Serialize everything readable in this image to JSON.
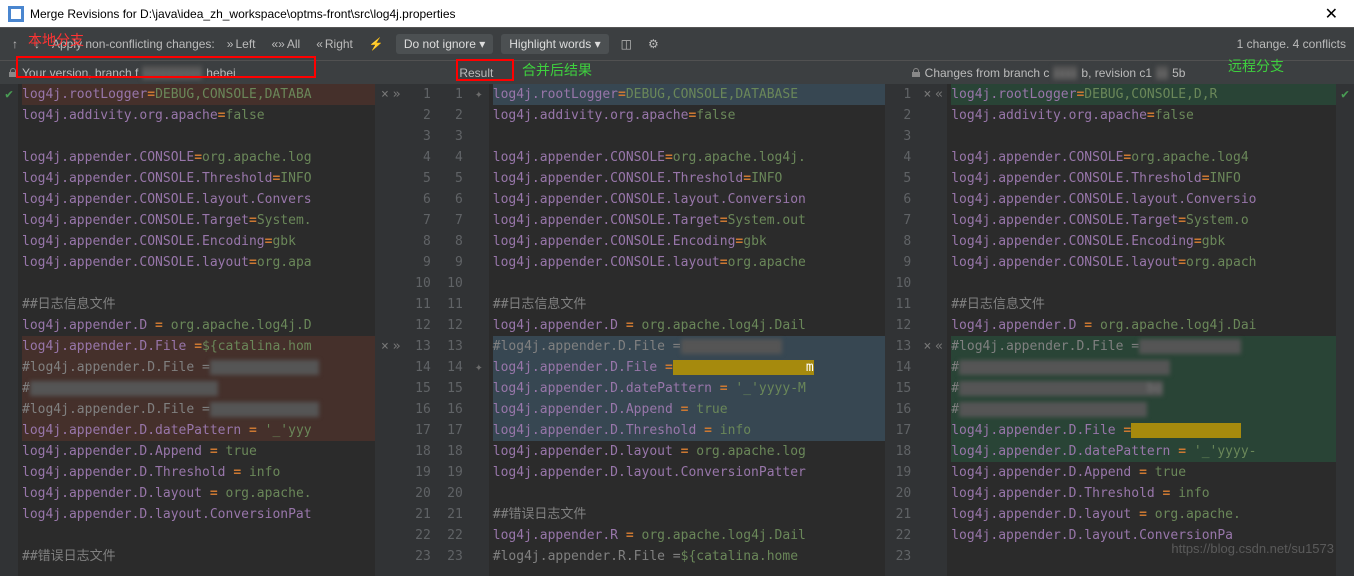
{
  "window": {
    "title": "Merge Revisions for D:\\java\\idea_zh_workspace\\optms-front\\src\\log4j.properties"
  },
  "toolbar": {
    "apply": "Apply non-conflicting changes:",
    "left": "Left",
    "all": "All",
    "right": "Right",
    "ignore": "Do not ignore",
    "highlight": "Highlight words",
    "status": "1 change. 4 conflicts"
  },
  "headers": {
    "left": "Your version, branch f",
    "left_tail": "hebei",
    "mid": "Result",
    "right": "Changes from branch c",
    "right_tail": "b, revision c1",
    "right_tail2": "5b"
  },
  "annotations": {
    "local": "本地分支",
    "result": "合并后结果",
    "remote": "远程分支"
  },
  "left_lines": [
    {
      "n": 1,
      "act": "× »",
      "cls": "conf-l",
      "tokens": [
        [
          "key",
          "log4j.rootLogger"
        ],
        [
          "kw",
          "="
        ],
        [
          "val",
          "DEBUG,CONSOLE,DATABA"
        ]
      ]
    },
    {
      "n": 2,
      "tokens": [
        [
          "key",
          "log4j.addivity.org.apache"
        ],
        [
          "kw",
          "="
        ],
        [
          "val",
          "false"
        ]
      ]
    },
    {
      "n": 3,
      "tokens": []
    },
    {
      "n": 4,
      "tokens": [
        [
          "key",
          "log4j.appender.CONSOLE"
        ],
        [
          "kw",
          "="
        ],
        [
          "val",
          "org.apache.log"
        ]
      ]
    },
    {
      "n": 5,
      "tokens": [
        [
          "key",
          "log4j.appender.CONSOLE.Threshold"
        ],
        [
          "kw",
          "="
        ],
        [
          "val",
          "INFO"
        ]
      ]
    },
    {
      "n": 6,
      "tokens": [
        [
          "key",
          "log4j.appender.CONSOLE.layout.Convers"
        ]
      ]
    },
    {
      "n": 7,
      "tokens": [
        [
          "key",
          "log4j.appender.CONSOLE.Target"
        ],
        [
          "kw",
          "="
        ],
        [
          "val",
          "System."
        ]
      ]
    },
    {
      "n": 8,
      "tokens": [
        [
          "key",
          "log4j.appender.CONSOLE.Encoding"
        ],
        [
          "kw",
          "="
        ],
        [
          "val",
          "gbk"
        ]
      ]
    },
    {
      "n": 9,
      "tokens": [
        [
          "key",
          "log4j.appender.CONSOLE.layout"
        ],
        [
          "kw",
          "="
        ],
        [
          "val",
          "org.apa"
        ]
      ]
    },
    {
      "n": 10,
      "tokens": []
    },
    {
      "n": 11,
      "tokens": [
        [
          "cmt",
          "##日志信息文件"
        ]
      ]
    },
    {
      "n": 12,
      "tokens": [
        [
          "key",
          "log4j.appender.D"
        ],
        [
          "kw",
          " = "
        ],
        [
          "val",
          "org.apache.log4j.D"
        ]
      ]
    },
    {
      "n": 13,
      "act": "× »",
      "cls": "conf-l",
      "tokens": [
        [
          "key",
          "log4j.appender.D.File"
        ],
        [
          "kw",
          " ="
        ],
        [
          "val",
          "${catalina.hom"
        ]
      ]
    },
    {
      "n": 14,
      "cls": "conf-l",
      "tokens": [
        [
          "cmt",
          "#log4j.appender.D.File ="
        ],
        [
          "blur",
          "              "
        ]
      ]
    },
    {
      "n": 15,
      "cls": "conf-l",
      "tokens": [
        [
          "cmt",
          "#"
        ],
        [
          "blur",
          "                        "
        ]
      ]
    },
    {
      "n": 16,
      "cls": "conf-l",
      "tokens": [
        [
          "cmt",
          "#log4j.appender.D.File ="
        ],
        [
          "blur",
          "              "
        ]
      ]
    },
    {
      "n": 17,
      "cls": "conf-l",
      "tokens": [
        [
          "key",
          "log4j.appender.D.datePattern"
        ],
        [
          "kw",
          " = "
        ],
        [
          "str",
          "'_'yyy"
        ]
      ]
    },
    {
      "n": 18,
      "tokens": [
        [
          "key",
          "log4j.appender.D.Append"
        ],
        [
          "kw",
          " = "
        ],
        [
          "val",
          "true"
        ]
      ]
    },
    {
      "n": 19,
      "tokens": [
        [
          "key",
          "log4j.appender.D.Threshold"
        ],
        [
          "kw",
          " = "
        ],
        [
          "val",
          "info"
        ]
      ]
    },
    {
      "n": 20,
      "tokens": [
        [
          "key",
          "log4j.appender.D.layout"
        ],
        [
          "kw",
          " = "
        ],
        [
          "val",
          "org.apache."
        ]
      ]
    },
    {
      "n": 21,
      "tokens": [
        [
          "key",
          "log4j.appender.D.layout.ConversionPat"
        ]
      ]
    },
    {
      "n": 22,
      "tokens": []
    },
    {
      "n": 23,
      "tokens": [
        [
          "cmt",
          "##错误日志文件"
        ]
      ]
    }
  ],
  "mid_lines": [
    {
      "n": 1,
      "cls": "conf-mid",
      "tokens": [
        [
          "key",
          "log4j.rootLogger"
        ],
        [
          "kw",
          "="
        ],
        [
          "val",
          "DEBUG,CONSOLE,DATABASE"
        ]
      ]
    },
    {
      "n": 2,
      "tokens": [
        [
          "key",
          "log4j.addivity.org.apache"
        ],
        [
          "kw",
          "="
        ],
        [
          "val",
          "false"
        ]
      ]
    },
    {
      "n": 3,
      "tokens": []
    },
    {
      "n": 4,
      "tokens": [
        [
          "key",
          "log4j.appender.CONSOLE"
        ],
        [
          "kw",
          "="
        ],
        [
          "val",
          "org.apache.log4j."
        ]
      ]
    },
    {
      "n": 5,
      "tokens": [
        [
          "key",
          "log4j.appender.CONSOLE.Threshold"
        ],
        [
          "kw",
          "="
        ],
        [
          "val",
          "INFO"
        ]
      ]
    },
    {
      "n": 6,
      "tokens": [
        [
          "key",
          "log4j.appender.CONSOLE.layout.Conversion"
        ]
      ]
    },
    {
      "n": 7,
      "tokens": [
        [
          "key",
          "log4j.appender.CONSOLE.Target"
        ],
        [
          "kw",
          "="
        ],
        [
          "val",
          "System.out"
        ]
      ]
    },
    {
      "n": 8,
      "tokens": [
        [
          "key",
          "log4j.appender.CONSOLE.Encoding"
        ],
        [
          "kw",
          "="
        ],
        [
          "val",
          "gbk"
        ]
      ]
    },
    {
      "n": 9,
      "tokens": [
        [
          "key",
          "log4j.appender.CONSOLE.layout"
        ],
        [
          "kw",
          "="
        ],
        [
          "val",
          "org.apache"
        ]
      ]
    },
    {
      "n": 10,
      "tokens": []
    },
    {
      "n": 11,
      "tokens": [
        [
          "cmt",
          "##日志信息文件"
        ]
      ]
    },
    {
      "n": 12,
      "tokens": [
        [
          "key",
          "log4j.appender.D"
        ],
        [
          "kw",
          " = "
        ],
        [
          "val",
          "org.apache.log4j.Dail"
        ]
      ]
    },
    {
      "n": 13,
      "cls": "conf-mid",
      "tokens": [
        [
          "cmt",
          "#log4j.appender.D.File ="
        ],
        [
          "blur",
          "             "
        ]
      ]
    },
    {
      "n": 14,
      "cls": "conf-mid",
      "tokens": [
        [
          "key",
          "log4j.appender.D.File"
        ],
        [
          "kw",
          " ="
        ],
        [
          "yellow",
          "                 m"
        ]
      ]
    },
    {
      "n": 15,
      "cls": "conf-mid",
      "tokens": [
        [
          "key",
          "log4j.appender.D.datePattern"
        ],
        [
          "kw",
          " = "
        ],
        [
          "str",
          "'_'yyyy-M"
        ]
      ]
    },
    {
      "n": 16,
      "cls": "conf-mid",
      "tokens": [
        [
          "key",
          "log4j.appender.D.Append"
        ],
        [
          "kw",
          " = "
        ],
        [
          "val",
          "true"
        ]
      ]
    },
    {
      "n": 17,
      "cls": "conf-mid",
      "tokens": [
        [
          "key",
          "log4j.appender.D.Threshold"
        ],
        [
          "kw",
          " = "
        ],
        [
          "val",
          "info"
        ]
      ]
    },
    {
      "n": 18,
      "tokens": [
        [
          "key",
          "log4j.appender.D.layout"
        ],
        [
          "kw",
          " = "
        ],
        [
          "val",
          "org.apache.log"
        ]
      ]
    },
    {
      "n": 19,
      "tokens": [
        [
          "key",
          "log4j.appender.D.layout.ConversionPatter"
        ]
      ]
    },
    {
      "n": 20,
      "tokens": []
    },
    {
      "n": 21,
      "tokens": [
        [
          "cmt",
          "##错误日志文件"
        ]
      ]
    },
    {
      "n": 22,
      "tokens": [
        [
          "key",
          "log4j.appender.R"
        ],
        [
          "kw",
          " = "
        ],
        [
          "val",
          "org.apache.log4j.Dail"
        ]
      ]
    },
    {
      "n": 23,
      "tokens": [
        [
          "cmt",
          "#log4j.appender.R.File ="
        ],
        [
          "val",
          "${catalina.home"
        ]
      ]
    }
  ],
  "right_lines": [
    {
      "n": 1,
      "act": "× «",
      "cls": "conf-r",
      "tokens": [
        [
          "key",
          "log4j.rootLogger"
        ],
        [
          "kw",
          "="
        ],
        [
          "val",
          "DEBUG,CONSOLE,D,R"
        ]
      ]
    },
    {
      "n": 2,
      "tokens": [
        [
          "key",
          "log4j.addivity.org.apache"
        ],
        [
          "kw",
          "="
        ],
        [
          "val",
          "false"
        ]
      ]
    },
    {
      "n": 3,
      "tokens": []
    },
    {
      "n": 4,
      "tokens": [
        [
          "key",
          "log4j.appender.CONSOLE"
        ],
        [
          "kw",
          "="
        ],
        [
          "val",
          "org.apache.log4"
        ]
      ]
    },
    {
      "n": 5,
      "tokens": [
        [
          "key",
          "log4j.appender.CONSOLE.Threshold"
        ],
        [
          "kw",
          "="
        ],
        [
          "val",
          "INFO"
        ]
      ]
    },
    {
      "n": 6,
      "tokens": [
        [
          "key",
          "log4j.appender.CONSOLE.layout.Conversio"
        ]
      ]
    },
    {
      "n": 7,
      "tokens": [
        [
          "key",
          "log4j.appender.CONSOLE.Target"
        ],
        [
          "kw",
          "="
        ],
        [
          "val",
          "System.o"
        ]
      ]
    },
    {
      "n": 8,
      "tokens": [
        [
          "key",
          "log4j.appender.CONSOLE.Encoding"
        ],
        [
          "kw",
          "="
        ],
        [
          "val",
          "gbk"
        ]
      ]
    },
    {
      "n": 9,
      "tokens": [
        [
          "key",
          "log4j.appender.CONSOLE.layout"
        ],
        [
          "kw",
          "="
        ],
        [
          "val",
          "org.apach"
        ]
      ]
    },
    {
      "n": 10,
      "tokens": []
    },
    {
      "n": 11,
      "tokens": [
        [
          "cmt",
          "##日志信息文件"
        ]
      ]
    },
    {
      "n": 12,
      "tokens": [
        [
          "key",
          "log4j.appender.D"
        ],
        [
          "kw",
          " = "
        ],
        [
          "val",
          "org.apache.log4j.Dai"
        ]
      ]
    },
    {
      "n": 13,
      "act": "× «",
      "cls": "conf-r",
      "tokens": [
        [
          "cmt",
          "#log4j.appender.D.File ="
        ],
        [
          "blur",
          "             "
        ]
      ]
    },
    {
      "n": 14,
      "cls": "conf-r",
      "tokens": [
        [
          "cmt",
          "#"
        ],
        [
          "blur",
          "                           "
        ]
      ]
    },
    {
      "n": 15,
      "cls": "conf-r",
      "tokens": [
        [
          "cmt",
          "#"
        ],
        [
          "blur",
          "                        bo"
        ]
      ]
    },
    {
      "n": 16,
      "cls": "conf-r",
      "tokens": [
        [
          "cmt",
          "#"
        ],
        [
          "blur",
          "                        "
        ]
      ]
    },
    {
      "n": 17,
      "cls": "conf-r",
      "tokens": [
        [
          "key",
          "log4j.appender.D.File"
        ],
        [
          "kw",
          " ="
        ],
        [
          "yellow",
          "              "
        ]
      ]
    },
    {
      "n": 18,
      "cls": "conf-r",
      "tokens": [
        [
          "key",
          "log4j.appender.D.datePattern"
        ],
        [
          "kw",
          " = "
        ],
        [
          "str",
          "'_'yyyy-"
        ]
      ]
    },
    {
      "n": 19,
      "tokens": [
        [
          "key",
          "log4j.appender.D.Append"
        ],
        [
          "kw",
          " = "
        ],
        [
          "val",
          "true"
        ]
      ]
    },
    {
      "n": 20,
      "tokens": [
        [
          "key",
          "log4j.appender.D.Threshold"
        ],
        [
          "kw",
          " = "
        ],
        [
          "val",
          "info"
        ]
      ]
    },
    {
      "n": 21,
      "tokens": [
        [
          "key",
          "log4j.appender.D.layout"
        ],
        [
          "kw",
          " = "
        ],
        [
          "val",
          "org.apache."
        ]
      ]
    },
    {
      "n": 22,
      "tokens": [
        [
          "key",
          "log4j.appender.D.layout.ConversionPa"
        ]
      ]
    },
    {
      "n": 23,
      "tokens": []
    }
  ],
  "watermark": "https://blog.csdn.net/su1573"
}
